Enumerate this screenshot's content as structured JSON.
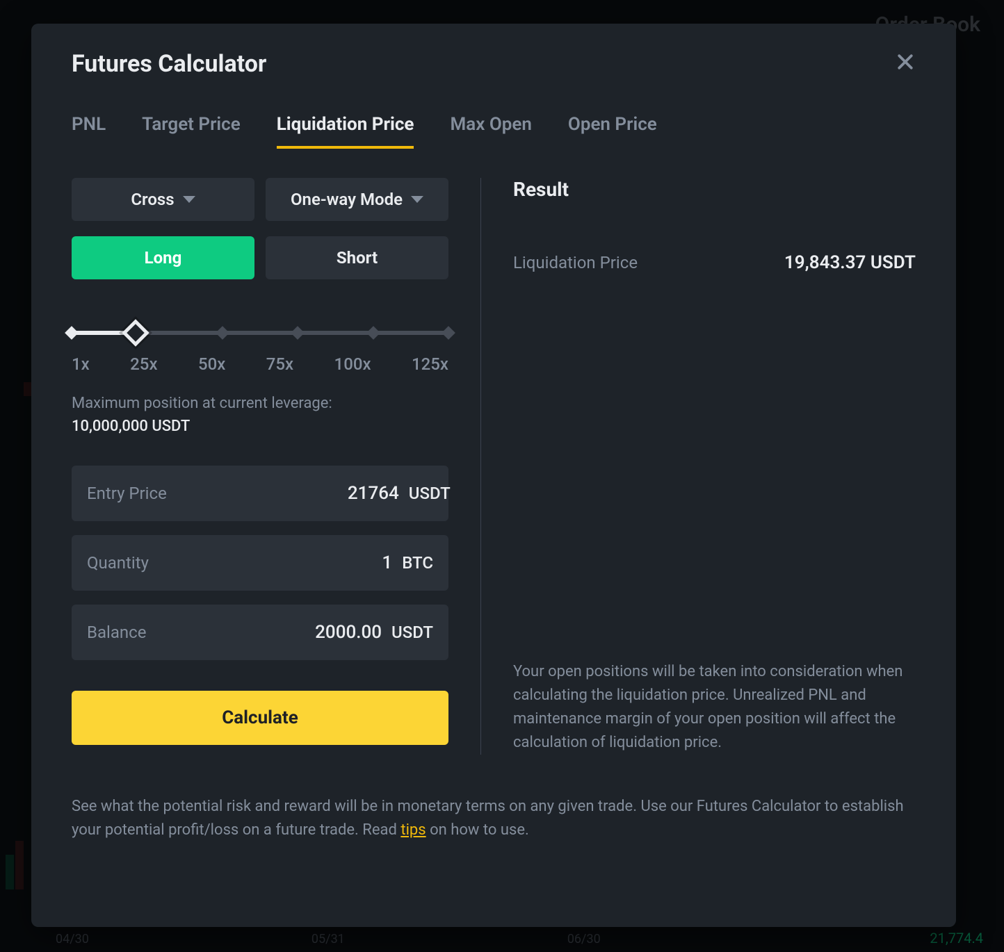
{
  "background": {
    "order_book_label": "Order Book",
    "axis": [
      "04/30",
      "05/31",
      "06/30"
    ],
    "right_price": "21,774.4"
  },
  "modal": {
    "title": "Futures Calculator",
    "tabs": [
      "PNL",
      "Target Price",
      "Liquidation Price",
      "Max Open",
      "Open Price"
    ],
    "active_tab_index": 2,
    "margin_mode": "Cross",
    "position_mode": "One-way Mode",
    "side_long": "Long",
    "side_short": "Short",
    "active_side": "long",
    "leverage": {
      "ticks": [
        "1x",
        "25x",
        "50x",
        "75x",
        "100x",
        "125x"
      ],
      "selected_index": 1
    },
    "max_position_label": "Maximum position at current leverage:",
    "max_position_value": "10,000,000 USDT",
    "fields": {
      "entry_price": {
        "label": "Entry Price",
        "value": "21764",
        "unit": "USDT"
      },
      "quantity": {
        "label": "Quantity",
        "value": "1",
        "unit": "BTC"
      },
      "balance": {
        "label": "Balance",
        "value": "2000.00",
        "unit": "USDT"
      }
    },
    "calculate_label": "Calculate",
    "result": {
      "title": "Result",
      "label": "Liquidation Price",
      "value": "19,843.37 USDT",
      "note": "Your open positions will be taken into consideration when calculating the liquidation price. Unrealized PNL and maintenance margin of your open position will affect the calculation of liquidation price."
    },
    "footer": {
      "text_before_link": "See what the potential risk and reward will be in monetary terms on any given trade. Use our Futures Calculator to establish your potential profit/loss on a future trade. Read ",
      "link_text": "tips",
      "text_after_link": " on how to use."
    }
  }
}
